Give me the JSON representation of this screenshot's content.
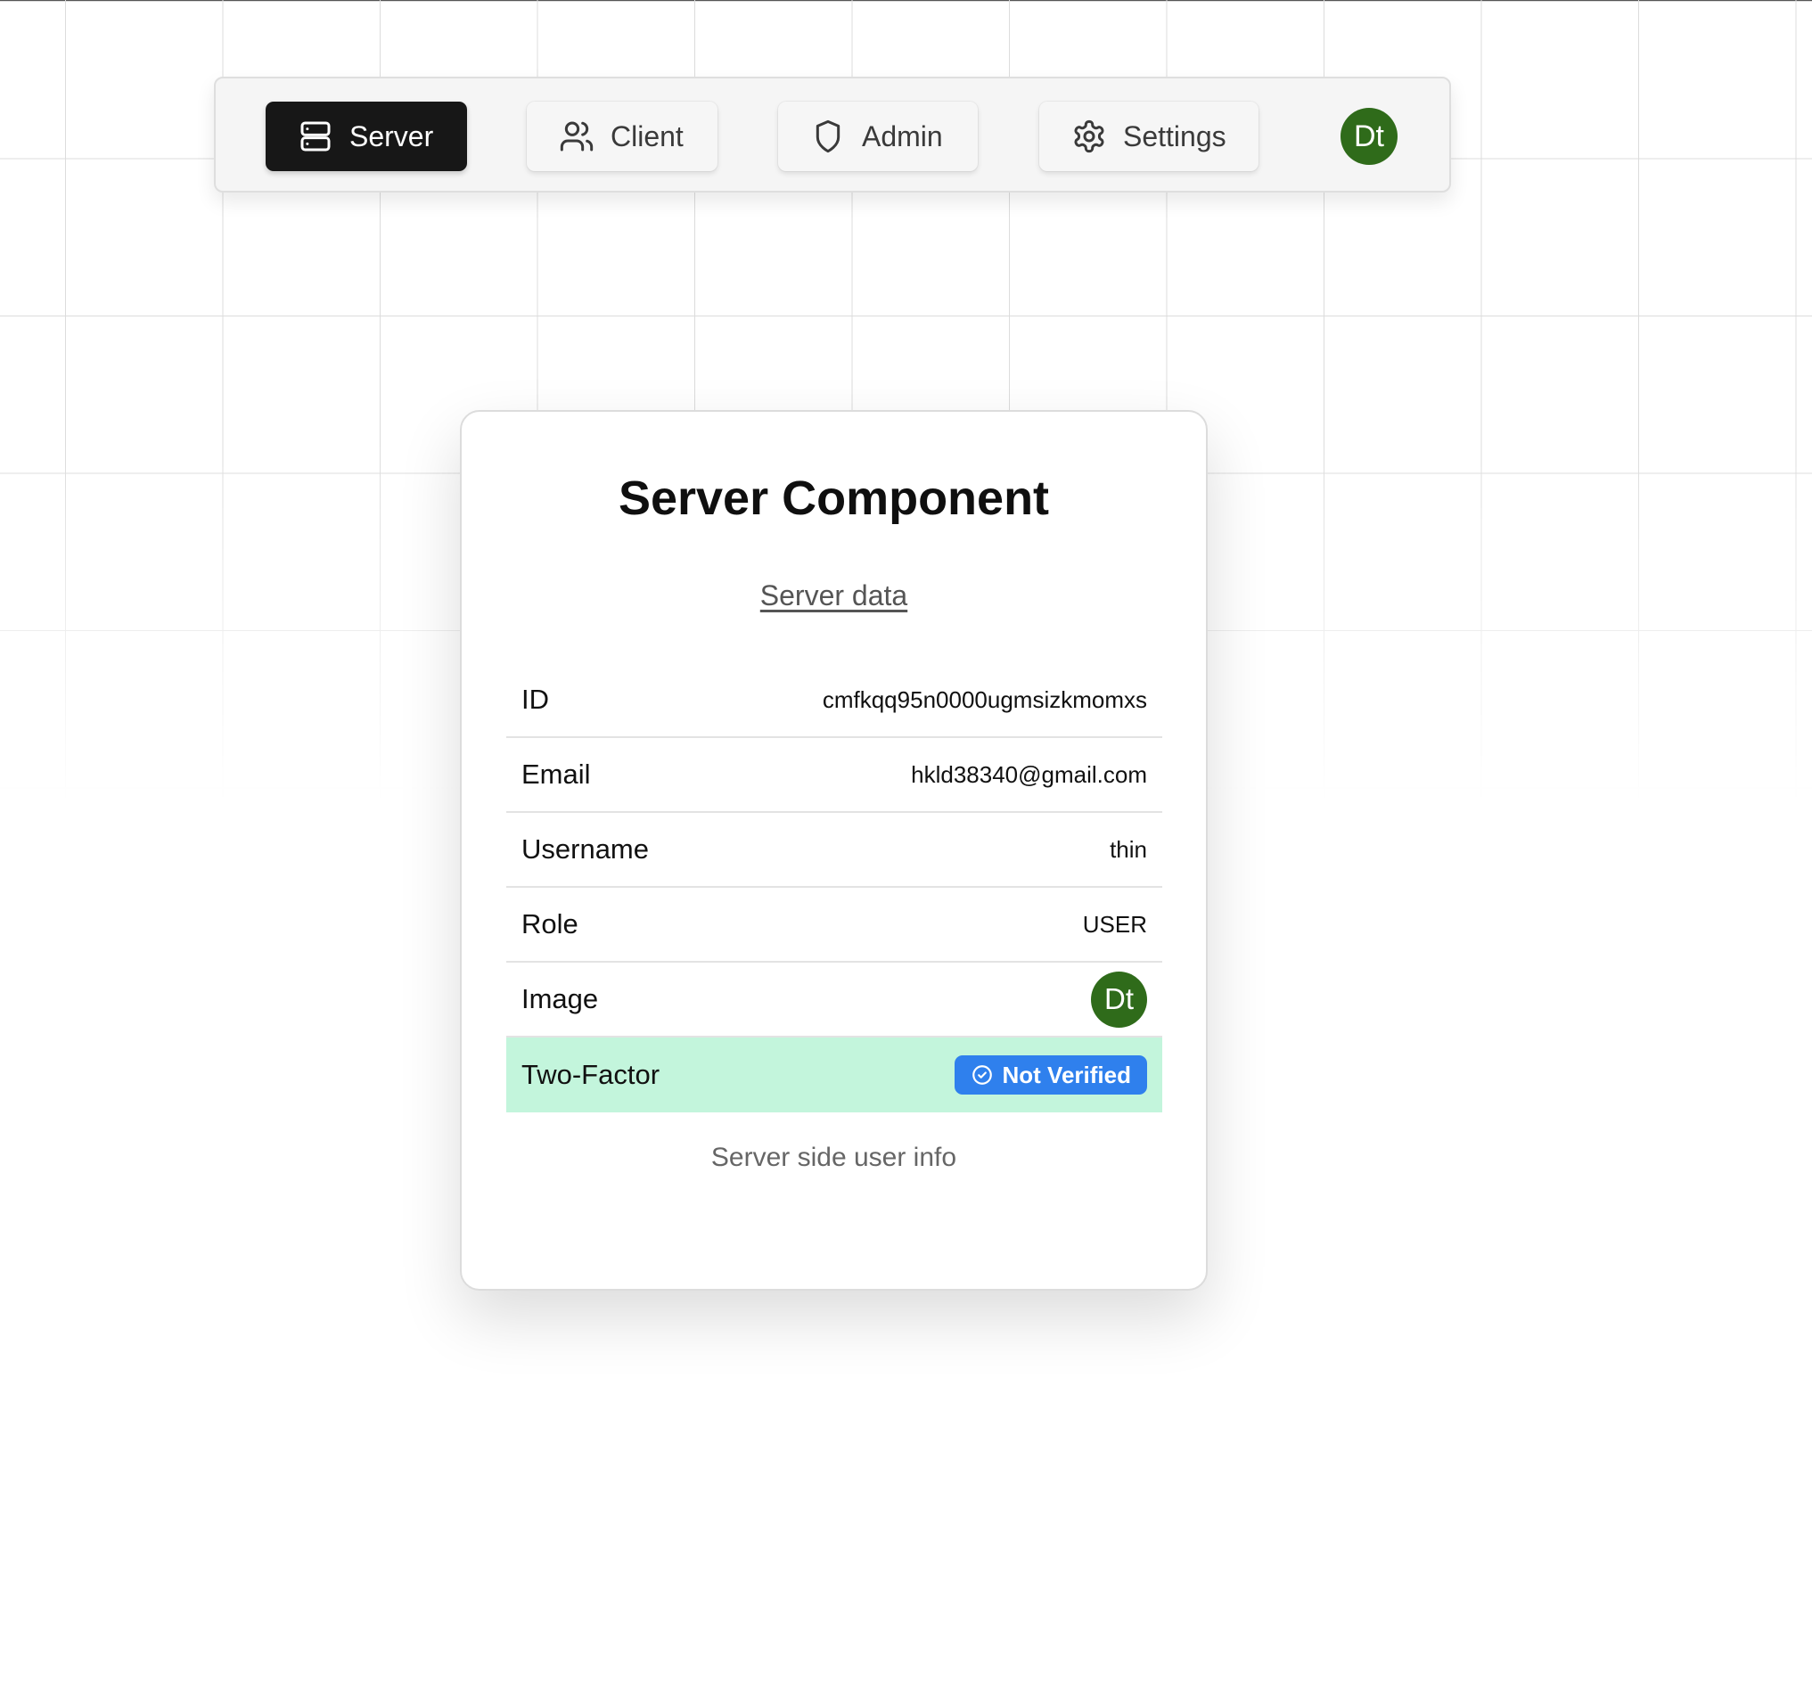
{
  "nav": {
    "items": [
      {
        "label": "Server",
        "icon": "server-icon",
        "active": true
      },
      {
        "label": "Client",
        "icon": "users-icon",
        "active": false
      },
      {
        "label": "Admin",
        "icon": "shield-icon",
        "active": false
      },
      {
        "label": "Settings",
        "icon": "gear-icon",
        "active": false
      }
    ],
    "avatar_initials": "Dt"
  },
  "card": {
    "title": "Server Component",
    "subtitle": "Server data",
    "rows": [
      {
        "label": "ID",
        "value": "cmfkqq95n0000ugmsizkmomxs"
      },
      {
        "label": "Email",
        "value": "hkld38340@gmail.com"
      },
      {
        "label": "Username",
        "value": "thin"
      },
      {
        "label": "Role",
        "value": "USER"
      },
      {
        "label": "Image",
        "avatar_initials": "Dt"
      },
      {
        "label": "Two-Factor",
        "badge": "Not Verified",
        "badge_icon": "check-circle-icon"
      }
    ],
    "footer": "Server side user info"
  },
  "colors": {
    "active_nav_bg": "#171717",
    "avatar_bg": "#2f6b1a",
    "highlight_row_bg": "#c3f5dc",
    "badge_bg": "#2f80ed"
  }
}
